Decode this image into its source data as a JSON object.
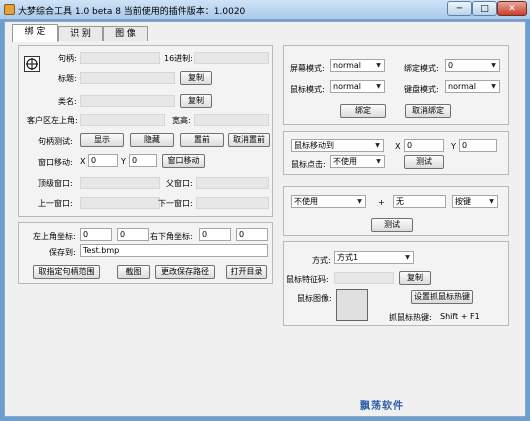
{
  "window": {
    "title": "大梦综合工具 1.0 beta 8    当前使用的插件版本：1.0020",
    "min": "─",
    "max": "□",
    "close": "✕"
  },
  "tabs": [
    {
      "label": "绑  定"
    },
    {
      "label": "识  别"
    },
    {
      "label": "图  像"
    }
  ],
  "info": {
    "handle_label": "句柄:",
    "hex_label": "16进制:",
    "title_label": "标题:",
    "copy1": "复制",
    "class_label": "类名:",
    "copy2": "复制",
    "client_label": "客户区左上角:",
    "width_label": "宽高:"
  },
  "handle_test": {
    "label": "句柄测试:",
    "show": "显示",
    "hide": "隐藏",
    "top": "置前",
    "untop": "取消置前"
  },
  "move": {
    "label": "窗口移动:",
    "x_label": "X",
    "x": "0",
    "y_label": "Y",
    "y": "0",
    "btn": "窗口移动"
  },
  "relations": {
    "top_label": "顶级窗口:",
    "parent_label": "父窗口:",
    "prev_label": "上一窗口:",
    "next_label": "下一窗口:"
  },
  "capture": {
    "tl_label": "左上角坐标:",
    "tl_x": "0",
    "tl_y": "0",
    "br_label": "右下角坐标:",
    "br_x": "0",
    "br_y": "0",
    "save_label": "保存到:",
    "save_path": "Test.bmp",
    "get_range": "取指定句柄范围",
    "shot": "截图",
    "change_path": "更改保存路径",
    "open_dir": "打开目录"
  },
  "bind": {
    "display_label": "屏幕模式:",
    "display": "normal",
    "bind_label": "绑定模式:",
    "bind_mode": "0",
    "mouse_label": "鼠标模式:",
    "mouse": "normal",
    "keypad_label": "键盘模式:",
    "keypad": "normal",
    "bind_btn": "绑定",
    "unbind_btn": "取消绑定"
  },
  "mouse_test": {
    "action": "鼠标移动到",
    "x_label": "X",
    "x": "0",
    "y_label": "Y",
    "y": "0",
    "click_label": "鼠标点击:",
    "click": "不使用",
    "test": "测试"
  },
  "key_test": {
    "mod": "不使用",
    "plus": "+",
    "key": "无",
    "type": "按键",
    "test": "测试"
  },
  "feature": {
    "mode_label": "方式:",
    "mode": "方式1",
    "code_label": "鼠标特征码:",
    "copy": "复制",
    "img_label": "鼠标图像:",
    "hotkey_btn": "设置抓鼠标热键",
    "hotkey_label": "抓鼠标热键:",
    "hotkey": "Shift + F1"
  },
  "watermark": "飘荡软件"
}
